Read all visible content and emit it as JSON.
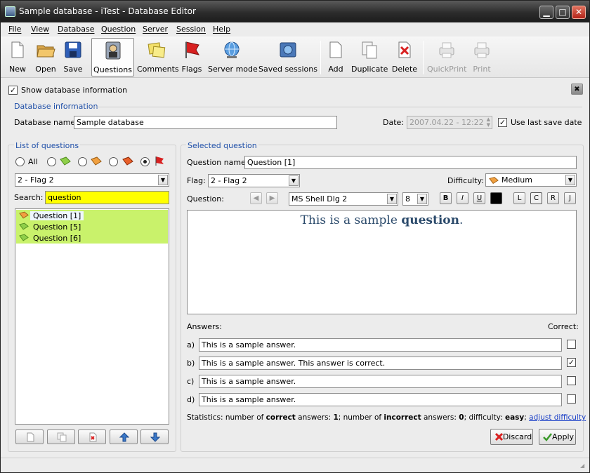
{
  "window": {
    "title": "Sample database - iTest - Database Editor"
  },
  "menubar": [
    "File",
    "View",
    "Database",
    "Question",
    "Server",
    "Session",
    "Help"
  ],
  "toolbar": {
    "new": "New",
    "open": "Open",
    "save": "Save",
    "questions": "Questions",
    "comments": "Comments",
    "flags": "Flags",
    "server_mode": "Server mode",
    "saved_sessions": "Saved sessions",
    "add": "Add",
    "duplicate": "Duplicate",
    "delete": "Delete",
    "quickprint": "QuickPrint",
    "print": "Print"
  },
  "show_db_info": {
    "label": "Show database information",
    "checked": true
  },
  "database_info": {
    "group_title": "Database information",
    "name_label": "Database name:",
    "name_value": "Sample database",
    "date_label": "Date:",
    "date_value": "2007.04.22 - 12:22",
    "use_last_save_label": "Use last save date",
    "use_last_save_checked": true
  },
  "list_of_questions": {
    "group_title": "List of questions",
    "filter_all": "All",
    "flag_combo": "2 - Flag 2",
    "search_label": "Search:",
    "search_value": "question",
    "items": [
      "Question [1]",
      "Question [5]",
      "Question [6]"
    ]
  },
  "selected_question": {
    "group_title": "Selected question",
    "name_label": "Question name:",
    "name_value": "Question [1]",
    "flag_label": "Flag:",
    "flag_value": "2 - Flag 2",
    "difficulty_label": "Difficulty:",
    "difficulty_value": "Medium",
    "question_label": "Question:",
    "font_value": "MS Shell Dlg 2",
    "size_value": "8",
    "fmt_bold": "B",
    "fmt_italic": "I",
    "fmt_underline": "U",
    "align_left": "L",
    "align_center": "C",
    "align_right": "R",
    "align_justify": "J",
    "text_plain": "This is a sample ",
    "text_bold": "question",
    "text_end": ".",
    "answers_label": "Answers:",
    "correct_label": "Correct:",
    "answers": [
      {
        "letter": "a)",
        "text": "This is a sample answer.",
        "correct": false
      },
      {
        "letter": "b)",
        "text": "This is a sample answer. This answer is correct.",
        "correct": true
      },
      {
        "letter": "c)",
        "text": "This is a sample answer.",
        "correct": false
      },
      {
        "letter": "d)",
        "text": "This is a sample answer.",
        "correct": false
      }
    ],
    "stats": {
      "p1": "Statistics: number of ",
      "b1": "correct",
      "p2": " answers: ",
      "b2": "1",
      "p3": "; number of ",
      "b3": "incorrect",
      "p4": " answers: ",
      "b4": "0",
      "p5": "; difficulty: ",
      "b5": "easy",
      "p6": "; ",
      "link": "adjust difficulty"
    },
    "discard": "Discard",
    "apply": "Apply"
  },
  "colors": {
    "group_title": "#1f4fa8",
    "list_highlight": "#c9f26b",
    "search_bg": "#ffff00",
    "flag_orange": "#f0a040",
    "flag_green": "#8fcf4a",
    "flag_red": "#d82020"
  }
}
